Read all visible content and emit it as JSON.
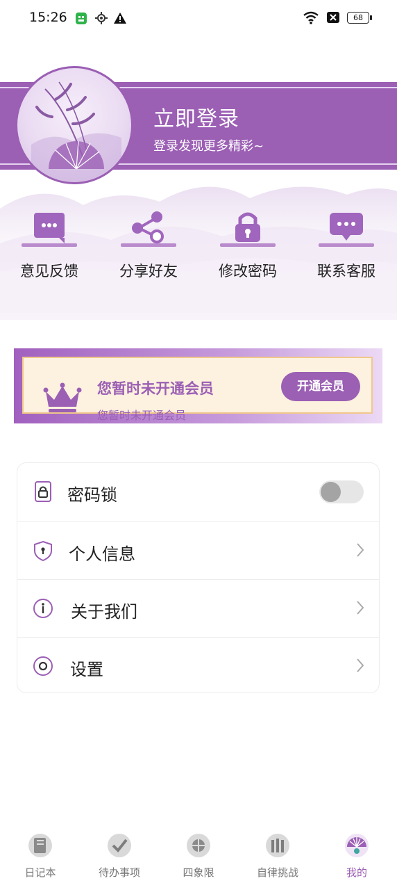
{
  "status_bar": {
    "time": "15:26",
    "battery": "68"
  },
  "header": {
    "title": "立即登录",
    "subtitle": "登录发现更多精彩~"
  },
  "quick_actions": [
    {
      "label": "意见反馈",
      "icon": "feedback-chat-icon"
    },
    {
      "label": "分享好友",
      "icon": "share-icon"
    },
    {
      "label": "修改密码",
      "icon": "lock-icon"
    },
    {
      "label": "联系客服",
      "icon": "customer-service-chat-icon"
    }
  ],
  "vip": {
    "title": "您暂时未开通会员",
    "subtitle": "您暂时未开通会员",
    "button": "开通会员",
    "icon": "crown-icon"
  },
  "settings": [
    {
      "label": "密码锁",
      "icon": "padlock-icon",
      "control": "toggle",
      "toggle_on": false
    },
    {
      "label": "个人信息",
      "icon": "shield-keyhole-icon",
      "control": "chevron"
    },
    {
      "label": "关于我们",
      "icon": "info-icon",
      "control": "chevron"
    },
    {
      "label": "设置",
      "icon": "settings-circle-icon",
      "control": "chevron"
    }
  ],
  "tabs": [
    {
      "label": "日记本",
      "active": false
    },
    {
      "label": "待办事项",
      "active": false
    },
    {
      "label": "四象限",
      "active": false
    },
    {
      "label": "自律挑战",
      "active": false
    },
    {
      "label": "我的",
      "active": true
    }
  ],
  "colors": {
    "accent": "#9b5fb4",
    "vip_bg": "#fdf1df",
    "vip_border": "#f0c88a"
  }
}
